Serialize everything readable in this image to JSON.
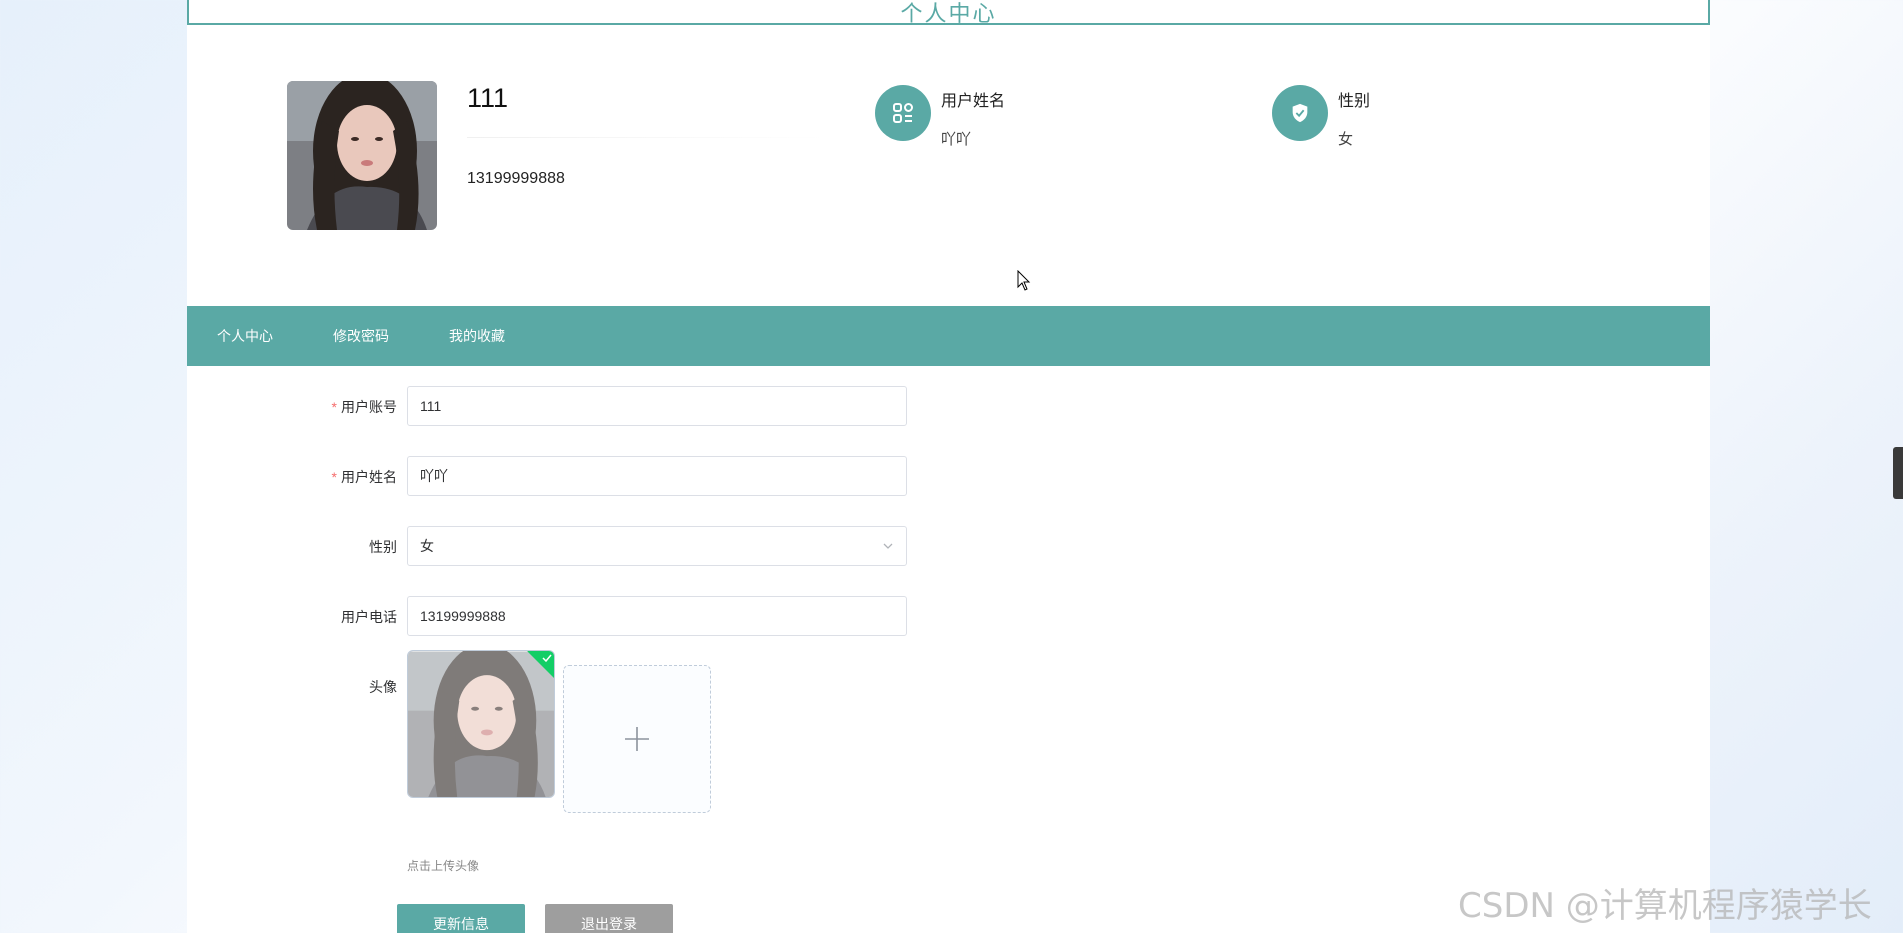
{
  "header": {
    "title": "个人中心"
  },
  "profile": {
    "account": "111",
    "phone": "13199999888",
    "info": [
      {
        "label": "用户姓名",
        "value": "吖吖",
        "icon": "list-grid-icon"
      },
      {
        "label": "性别",
        "value": "女",
        "icon": "shield-check-icon"
      }
    ]
  },
  "tabs": [
    "个人中心",
    "修改密码",
    "我的收藏"
  ],
  "form": {
    "account_label": "用户账号",
    "account_value": "111",
    "name_label": "用户姓名",
    "name_value": "吖吖",
    "gender_label": "性别",
    "gender_value": "女",
    "phone_label": "用户电话",
    "phone_value": "13199999888",
    "avatar_label": "头像",
    "upload_hint": "点击上传头像",
    "required_mark": "*"
  },
  "buttons": {
    "update": "更新信息",
    "logout": "退出登录"
  },
  "watermark": "CSDN @计算机程序猿学长",
  "colors": {
    "accent": "#5aa9a5",
    "required": "#f56c6c",
    "logout": "#9e9e9e"
  }
}
